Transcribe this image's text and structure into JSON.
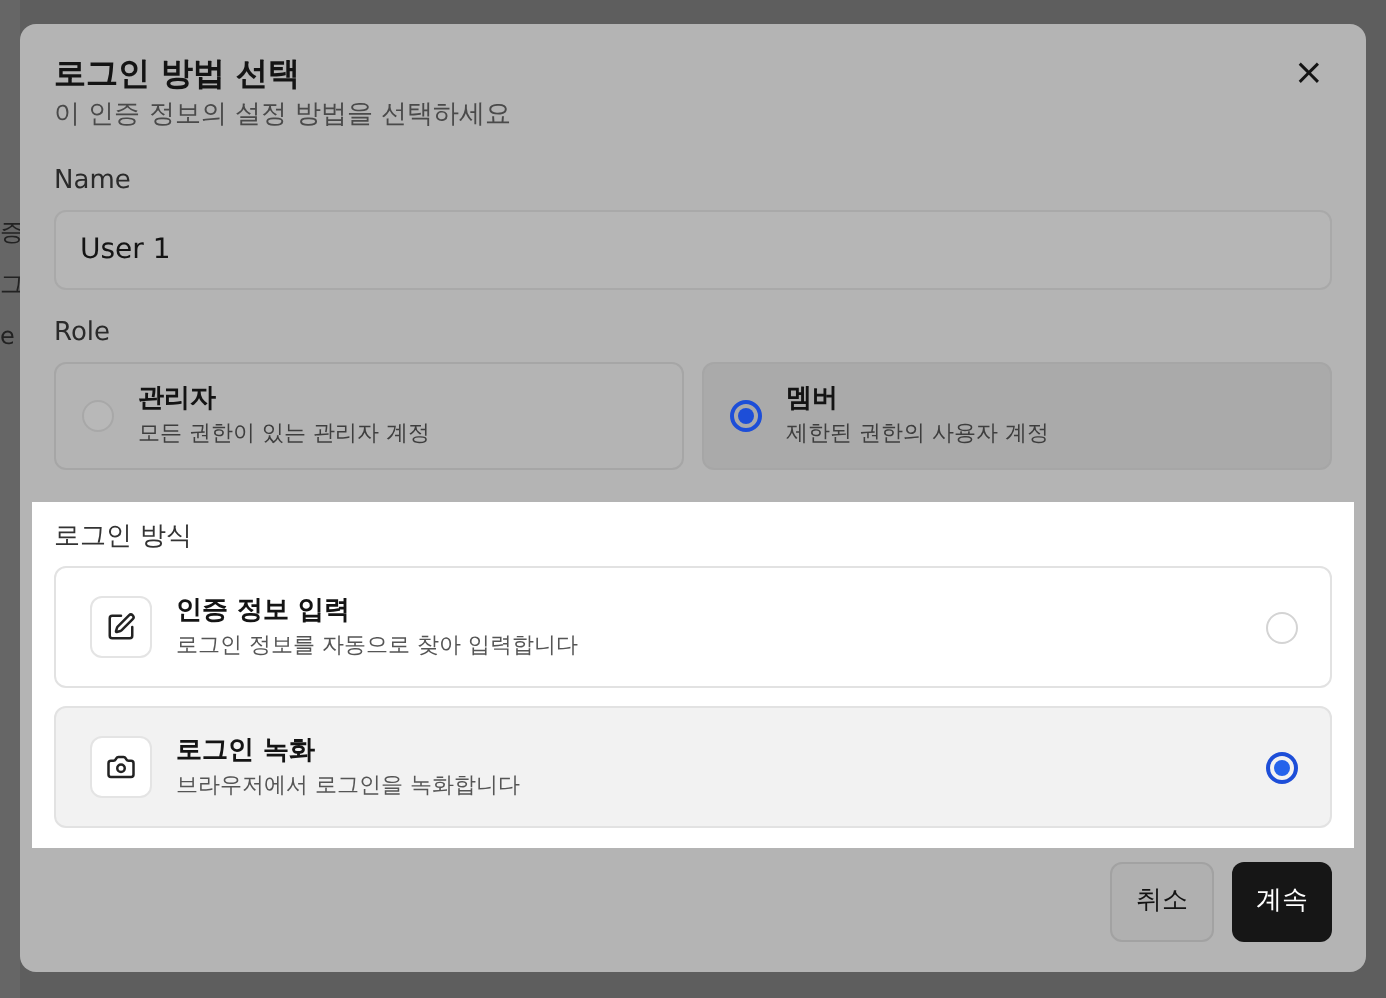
{
  "background_fragments": [
    "증",
    "그",
    "e"
  ],
  "dialog": {
    "title": "로그인 방법 선택",
    "subtitle": "이 인증 정보의 설정 방법을 선택하세요",
    "close": "×"
  },
  "name_field": {
    "label": "Name",
    "value": "User 1"
  },
  "role": {
    "label": "Role",
    "options": [
      {
        "title": "관리자",
        "description": "모든 권한이 있는 관리자 계정",
        "selected": false
      },
      {
        "title": "멤버",
        "description": "제한된 권한의 사용자 계정",
        "selected": true
      }
    ]
  },
  "login_method": {
    "label": "로그인 방식",
    "highlighted": true,
    "options": [
      {
        "kind": "pencil",
        "title": "인증 정보 입력",
        "description": "로그인 정보를 자동으로 찾아 입력합니다",
        "selected": false
      },
      {
        "kind": "camera",
        "title": "로그인 녹화",
        "description": "브라우저에서 로그인을 녹화합니다",
        "selected": true
      }
    ]
  },
  "buttons": [
    {
      "label": "취소",
      "kind": "secondary"
    },
    {
      "label": "계속",
      "kind": "primary"
    }
  ]
}
